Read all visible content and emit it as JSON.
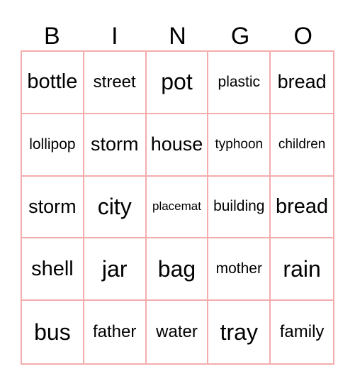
{
  "card": {
    "header": [
      "B",
      "I",
      "N",
      "G",
      "O"
    ],
    "line_color": "#f4acac",
    "rows": [
      [
        "bottle",
        "street",
        "pot",
        "plastic",
        "bread"
      ],
      [
        "lollipop",
        "storm",
        "house",
        "typhoon",
        "children"
      ],
      [
        "storm",
        "city",
        "placemat",
        "building",
        "bread"
      ],
      [
        "shell",
        "jar",
        "bag",
        "mother",
        "rain"
      ],
      [
        "bus",
        "father",
        "water",
        "tray",
        "family"
      ]
    ]
  }
}
